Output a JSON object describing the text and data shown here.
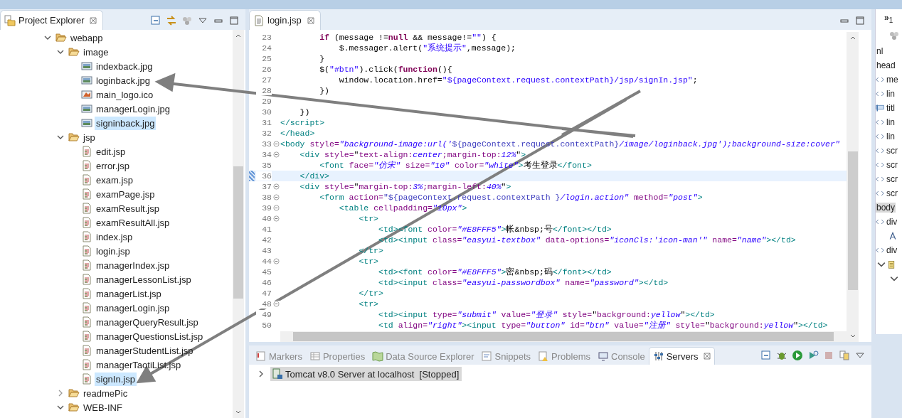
{
  "project_explorer": {
    "title": "Project Explorer",
    "tree": [
      {
        "label": "webapp",
        "kind": "folder",
        "expanded": true,
        "selected": false,
        "children": [
          {
            "label": "image",
            "kind": "folder",
            "expanded": true,
            "selected": false,
            "children": [
              {
                "label": "indexback.jpg",
                "kind": "image",
                "selected": false
              },
              {
                "label": "loginback.jpg",
                "kind": "image",
                "selected": false
              },
              {
                "label": "main_logo.ico",
                "kind": "ico",
                "selected": false
              },
              {
                "label": "managerLogin.jpg",
                "kind": "image",
                "selected": false
              },
              {
                "label": "signinback.jpg",
                "kind": "image",
                "selected": true
              }
            ]
          },
          {
            "label": "jsp",
            "kind": "folder",
            "expanded": true,
            "selected": false,
            "children": [
              {
                "label": "edit.jsp",
                "kind": "jsp",
                "selected": false
              },
              {
                "label": "error.jsp",
                "kind": "jsp",
                "selected": false
              },
              {
                "label": "exam.jsp",
                "kind": "jsp",
                "selected": false
              },
              {
                "label": "examPage.jsp",
                "kind": "jsp",
                "selected": false
              },
              {
                "label": "examResult.jsp",
                "kind": "jsp",
                "selected": false
              },
              {
                "label": "examResultAll.jsp",
                "kind": "jsp",
                "selected": false
              },
              {
                "label": "index.jsp",
                "kind": "jsp",
                "selected": false
              },
              {
                "label": "login.jsp",
                "kind": "jsp",
                "selected": false
              },
              {
                "label": "managerIndex.jsp",
                "kind": "jsp",
                "selected": false
              },
              {
                "label": "managerLessonList.jsp",
                "kind": "jsp",
                "selected": false
              },
              {
                "label": "managerList.jsp",
                "kind": "jsp",
                "selected": false
              },
              {
                "label": "managerLogin.jsp",
                "kind": "jsp",
                "selected": false
              },
              {
                "label": "managerQueryResult.jsp",
                "kind": "jsp",
                "selected": false
              },
              {
                "label": "managerQuestionsList.jsp",
                "kind": "jsp",
                "selected": false
              },
              {
                "label": "managerStudentList.jsp",
                "kind": "jsp",
                "selected": false
              },
              {
                "label": "managerTaotiList.jsp",
                "kind": "jsp",
                "selected": false
              },
              {
                "label": "signIn.jsp",
                "kind": "jsp",
                "selected": true
              }
            ]
          },
          {
            "label": "readmePic",
            "kind": "folder",
            "expanded": false,
            "selected": false
          },
          {
            "label": "WEB-INF",
            "kind": "folder",
            "expanded": true,
            "selected": false
          }
        ]
      }
    ]
  },
  "editor": {
    "tab": "login.jsp",
    "lines": [
      {
        "number": "23",
        "fold": false,
        "current": false,
        "segments": [
          {
            "kind": "kw",
            "text": "        if"
          },
          {
            "kind": "plain",
            "text": " (message !="
          },
          {
            "kind": "kw",
            "text": "null"
          },
          {
            "kind": "plain",
            "text": " && message!="
          },
          {
            "kind": "str",
            "text": "\"\""
          },
          {
            "kind": "plain",
            "text": ") {"
          }
        ]
      },
      {
        "number": "24",
        "fold": false,
        "current": false,
        "segments": [
          {
            "kind": "plain",
            "text": "            $.messager.alert("
          },
          {
            "kind": "str",
            "text": "\"系统提示\""
          },
          {
            "kind": "plain",
            "text": ",message);"
          }
        ]
      },
      {
        "number": "25",
        "fold": false,
        "current": false,
        "segments": [
          {
            "kind": "plain",
            "text": "        }"
          }
        ]
      },
      {
        "number": "26",
        "fold": false,
        "current": false,
        "segments": [
          {
            "kind": "plain",
            "text": "        $("
          },
          {
            "kind": "str",
            "text": "\"#btn\""
          },
          {
            "kind": "plain",
            "text": ").click("
          },
          {
            "kind": "kw",
            "text": "function"
          },
          {
            "kind": "plain",
            "text": "(){"
          }
        ]
      },
      {
        "number": "27",
        "fold": false,
        "current": false,
        "segments": [
          {
            "kind": "plain",
            "text": "            window.location.href="
          },
          {
            "kind": "str",
            "text": "\"${pageContext.request.contextPath}/jsp/signIn.jsp\""
          },
          {
            "kind": "plain",
            "text": ";"
          }
        ]
      },
      {
        "number": "28",
        "fold": false,
        "current": false,
        "segments": [
          {
            "kind": "plain",
            "text": "        })"
          }
        ]
      },
      {
        "number": "29",
        "fold": false,
        "current": false
      },
      {
        "number": "30",
        "fold": false,
        "current": false,
        "segments": [
          {
            "kind": "plain",
            "text": "    })"
          }
        ]
      },
      {
        "number": "31",
        "fold": false,
        "current": false,
        "segments": [
          {
            "kind": "tag",
            "text": "</script>"
          }
        ]
      },
      {
        "number": "32",
        "fold": false,
        "current": false,
        "segments": [
          {
            "kind": "tag",
            "text": "</head>"
          }
        ]
      },
      {
        "number": "33",
        "fold": true,
        "current": false,
        "segments": [
          {
            "kind": "tag",
            "text": "<body"
          },
          {
            "kind": "attr",
            "text": " style="
          },
          {
            "kind": "val",
            "text": "\"background-image:url('"
          },
          {
            "kind": "el",
            "text": "${pageContext.request.contextPath}"
          },
          {
            "kind": "val",
            "text": "/image/loginback.jpg');background-size:cover\""
          }
        ]
      },
      {
        "number": "34",
        "fold": true,
        "current": false,
        "segments": [
          {
            "kind": "tag",
            "text": "    <div"
          },
          {
            "kind": "attr",
            "text": " style="
          },
          {
            "kind": "plain",
            "text": "\""
          },
          {
            "kind": "attr",
            "text": "text-align:"
          },
          {
            "kind": "val",
            "text": "center"
          },
          {
            "kind": "attr",
            "text": ";margin-top:"
          },
          {
            "kind": "val",
            "text": "12%"
          },
          {
            "kind": "plain",
            "text": "\""
          },
          {
            "kind": "tag",
            "text": ">"
          }
        ]
      },
      {
        "number": "35",
        "fold": false,
        "current": false,
        "segments": [
          {
            "kind": "tag",
            "text": "        <font"
          },
          {
            "kind": "attr",
            "text": " face="
          },
          {
            "kind": "val",
            "text": "\"仿宋\""
          },
          {
            "kind": "attr",
            "text": " size="
          },
          {
            "kind": "val",
            "text": "\"10\""
          },
          {
            "kind": "attr",
            "text": " color="
          },
          {
            "kind": "val",
            "text": "\"white\""
          },
          {
            "kind": "tag",
            "text": ">"
          },
          {
            "kind": "plain",
            "text": "考生登录"
          },
          {
            "kind": "tag",
            "text": "</font>"
          }
        ]
      },
      {
        "number": "36",
        "fold": false,
        "current": true,
        "segments": [
          {
            "kind": "tag",
            "text": "    </div>"
          }
        ]
      },
      {
        "number": "37",
        "fold": true,
        "current": false,
        "segments": [
          {
            "kind": "tag",
            "text": "    <div"
          },
          {
            "kind": "attr",
            "text": " style="
          },
          {
            "kind": "plain",
            "text": "\""
          },
          {
            "kind": "attr",
            "text": "margin-top:"
          },
          {
            "kind": "val",
            "text": "3%"
          },
          {
            "kind": "attr",
            "text": ";margin-left:"
          },
          {
            "kind": "val",
            "text": "40%"
          },
          {
            "kind": "plain",
            "text": "\""
          },
          {
            "kind": "tag",
            "text": ">"
          }
        ]
      },
      {
        "number": "38",
        "fold": true,
        "current": false,
        "segments": [
          {
            "kind": "tag",
            "text": "        <form"
          },
          {
            "kind": "attr",
            "text": " action="
          },
          {
            "kind": "el",
            "text": "\"${pageContext.request.contextPath }"
          },
          {
            "kind": "val",
            "text": "/login.action\""
          },
          {
            "kind": "attr",
            "text": " method="
          },
          {
            "kind": "val",
            "text": "\"post\""
          },
          {
            "kind": "tag",
            "text": ">"
          }
        ]
      },
      {
        "number": "39",
        "fold": true,
        "current": false,
        "segments": [
          {
            "kind": "tag",
            "text": "            <table"
          },
          {
            "kind": "attr",
            "text": " cellpadding="
          },
          {
            "kind": "val",
            "text": "\"10px\""
          },
          {
            "kind": "tag",
            "text": ">"
          }
        ]
      },
      {
        "number": "40",
        "fold": true,
        "current": false,
        "segments": [
          {
            "kind": "tag",
            "text": "                <tr>"
          }
        ]
      },
      {
        "number": "41",
        "fold": false,
        "current": false,
        "segments": [
          {
            "kind": "tag",
            "text": "                    <td><font"
          },
          {
            "kind": "attr",
            "text": " color="
          },
          {
            "kind": "val",
            "text": "\"#E8FFF5\""
          },
          {
            "kind": "tag",
            "text": ">"
          },
          {
            "kind": "plain",
            "text": "帐&nbsp;号"
          },
          {
            "kind": "tag",
            "text": "</font></td>"
          }
        ]
      },
      {
        "number": "42",
        "fold": false,
        "current": false,
        "segments": [
          {
            "kind": "tag",
            "text": "                    <td><input"
          },
          {
            "kind": "attr",
            "text": " class="
          },
          {
            "kind": "val",
            "text": "\"easyui-textbox\""
          },
          {
            "kind": "attr",
            "text": " data-options="
          },
          {
            "kind": "val",
            "text": "\"iconCls:'icon-man'\""
          },
          {
            "kind": "attr",
            "text": " name="
          },
          {
            "kind": "val",
            "text": "\"name\""
          },
          {
            "kind": "tag",
            "text": "></td>"
          }
        ]
      },
      {
        "number": "43",
        "fold": false,
        "current": false,
        "segments": [
          {
            "kind": "tag",
            "text": "                </tr>"
          }
        ]
      },
      {
        "number": "44",
        "fold": true,
        "current": false,
        "segments": [
          {
            "kind": "tag",
            "text": "                <tr>"
          }
        ]
      },
      {
        "number": "45",
        "fold": false,
        "current": false,
        "segments": [
          {
            "kind": "tag",
            "text": "                    <td><font"
          },
          {
            "kind": "attr",
            "text": " color="
          },
          {
            "kind": "val",
            "text": "\"#E8FFF5\""
          },
          {
            "kind": "tag",
            "text": ">"
          },
          {
            "kind": "plain",
            "text": "密&nbsp;码"
          },
          {
            "kind": "tag",
            "text": "</font></td>"
          }
        ]
      },
      {
        "number": "46",
        "fold": false,
        "current": false,
        "segments": [
          {
            "kind": "tag",
            "text": "                    <td><input"
          },
          {
            "kind": "attr",
            "text": " class="
          },
          {
            "kind": "val",
            "text": "\"easyui-passwordbox\""
          },
          {
            "kind": "attr",
            "text": " name="
          },
          {
            "kind": "val",
            "text": "\"password\""
          },
          {
            "kind": "tag",
            "text": "></td>"
          }
        ]
      },
      {
        "number": "47",
        "fold": false,
        "current": false,
        "segments": [
          {
            "kind": "tag",
            "text": "                </tr>"
          }
        ]
      },
      {
        "number": "48",
        "fold": true,
        "current": false,
        "segments": [
          {
            "kind": "tag",
            "text": "                <tr>"
          }
        ]
      },
      {
        "number": "49",
        "fold": false,
        "current": false,
        "segments": [
          {
            "kind": "tag",
            "text": "                    <td><input"
          },
          {
            "kind": "attr",
            "text": " type="
          },
          {
            "kind": "val",
            "text": "\"submit\""
          },
          {
            "kind": "attr",
            "text": " value="
          },
          {
            "kind": "val",
            "text": "\"登录\""
          },
          {
            "kind": "attr",
            "text": " style="
          },
          {
            "kind": "plain",
            "text": "\""
          },
          {
            "kind": "attr",
            "text": "background:"
          },
          {
            "kind": "val",
            "text": "yellow"
          },
          {
            "kind": "plain",
            "text": "\""
          },
          {
            "kind": "tag",
            "text": "></td>"
          }
        ]
      },
      {
        "number": "50",
        "fold": false,
        "current": false,
        "segments": [
          {
            "kind": "tag",
            "text": "                    <td"
          },
          {
            "kind": "attr",
            "text": " align="
          },
          {
            "kind": "val",
            "text": "\"right\""
          },
          {
            "kind": "tag",
            "text": "><input"
          },
          {
            "kind": "attr",
            "text": " type="
          },
          {
            "kind": "val",
            "text": "\"button\""
          },
          {
            "kind": "attr",
            "text": " id="
          },
          {
            "kind": "val",
            "text": "\"btn\""
          },
          {
            "kind": "attr",
            "text": " value="
          },
          {
            "kind": "val",
            "text": "\"注册\""
          },
          {
            "kind": "attr",
            "text": " style="
          },
          {
            "kind": "plain",
            "text": "\""
          },
          {
            "kind": "attr",
            "text": "background:"
          },
          {
            "kind": "val",
            "text": "yellow"
          },
          {
            "kind": "plain",
            "text": "\""
          },
          {
            "kind": "tag",
            "text": "></td>"
          }
        ]
      }
    ]
  },
  "outline": {
    "overflow": "»",
    "count": "1",
    "items": [
      {
        "kind": "plain",
        "text": "nl",
        "selected": false
      },
      {
        "kind": "plain",
        "text": "head",
        "selected": false
      },
      {
        "kind": "tag",
        "text": "me",
        "selected": false
      },
      {
        "kind": "tag",
        "text": "lin",
        "selected": false
      },
      {
        "kind": "title",
        "text": "titl",
        "selected": false
      },
      {
        "kind": "tag",
        "text": "lin",
        "selected": false
      },
      {
        "kind": "tag",
        "text": "lin",
        "selected": false
      },
      {
        "kind": "tag",
        "text": "scr",
        "selected": false
      },
      {
        "kind": "tag",
        "text": "scr",
        "selected": false
      },
      {
        "kind": "tag",
        "text": "scr",
        "selected": false
      },
      {
        "kind": "tag",
        "text": "scr",
        "selected": false
      },
      {
        "kind": "plain",
        "text": "body",
        "selected": true
      },
      {
        "kind": "tag",
        "text": "div",
        "selected": false
      },
      {
        "kind": "font",
        "selected": false
      },
      {
        "kind": "tag",
        "text": "div",
        "selected": false
      },
      {
        "kind": "form",
        "selected": false
      },
      {
        "kind": "child",
        "selected": false
      }
    ]
  },
  "bottom_panel": {
    "tabs": [
      {
        "label": "Markers",
        "kind": "markers",
        "selected": false
      },
      {
        "label": "Properties",
        "kind": "properties",
        "selected": false
      },
      {
        "label": "Data Source Explorer",
        "kind": "datasource",
        "selected": false
      },
      {
        "label": "Snippets",
        "kind": "snippets",
        "selected": false
      },
      {
        "label": "Problems",
        "kind": "problems",
        "selected": false
      },
      {
        "label": "Console",
        "kind": "console",
        "selected": false
      },
      {
        "label": "Servers",
        "kind": "servers",
        "selected": true
      }
    ],
    "servers": [
      {
        "label": "Tomcat v8.0 Server at localhost  [Stopped]",
        "selected": true,
        "expanded": false
      }
    ]
  }
}
